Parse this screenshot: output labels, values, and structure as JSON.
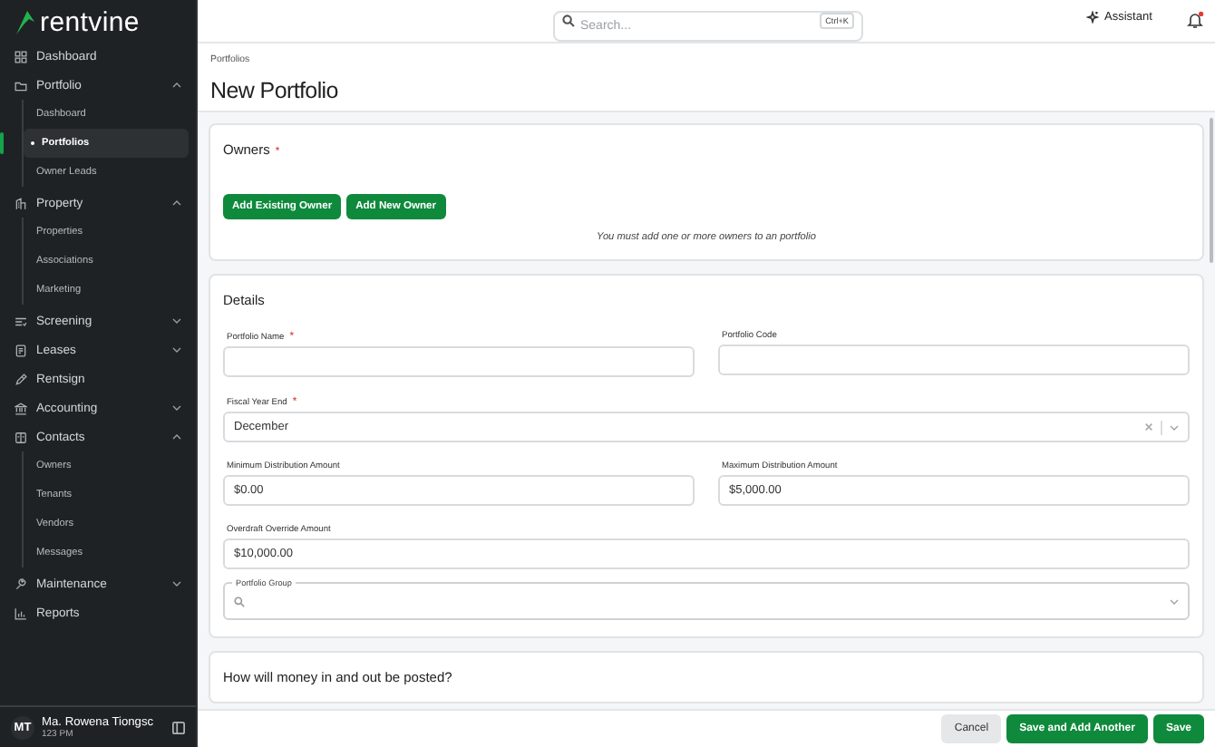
{
  "sidebar": {
    "logo": "rentvine",
    "items": [
      {
        "kind": "link",
        "label": "Dashboard"
      },
      {
        "kind": "group",
        "label": "Portfolio",
        "expanded": true,
        "children": [
          {
            "label": "Dashboard",
            "selected": false
          },
          {
            "label": "Portfolios",
            "selected": true
          },
          {
            "label": "Owner Leads",
            "selected": false
          }
        ]
      },
      {
        "kind": "group",
        "label": "Property",
        "expanded": true,
        "children": [
          {
            "label": "Properties",
            "selected": false
          },
          {
            "label": "Associations",
            "selected": false
          },
          {
            "label": "Marketing",
            "selected": false
          }
        ]
      },
      {
        "kind": "group",
        "label": "Screening",
        "expanded": false
      },
      {
        "kind": "group",
        "label": "Leases",
        "expanded": false
      },
      {
        "kind": "link",
        "label": "Rentsign"
      },
      {
        "kind": "group",
        "label": "Accounting",
        "expanded": false
      },
      {
        "kind": "group",
        "label": "Contacts",
        "expanded": true,
        "children": [
          {
            "label": "Owners",
            "selected": false
          },
          {
            "label": "Tenants",
            "selected": false
          },
          {
            "label": "Vendors",
            "selected": false
          },
          {
            "label": "Messages",
            "selected": false
          }
        ]
      },
      {
        "kind": "group",
        "label": "Maintenance",
        "expanded": false
      },
      {
        "kind": "link",
        "label": "Reports"
      }
    ],
    "user": {
      "initials": "MT",
      "name": "Ma. Rowena Tiongsc",
      "time": "123 PM"
    }
  },
  "topbar": {
    "search": {
      "placeholder": "Search...",
      "shortcut": "Ctrl+K"
    },
    "assistant": "Assistant",
    "notifications": {
      "unread": true
    }
  },
  "breadcrumb": "Portfolios",
  "title": "New Portfolio",
  "owners": {
    "title": "Owners",
    "required_mark": "*",
    "buttons": [
      "Add Existing Owner",
      "Add New Owner"
    ],
    "note": "You must add one or more owners to an portfolio"
  },
  "details": {
    "title": "Details",
    "rows": [
      [
        {
          "kind": "text",
          "label": "Portfolio Name",
          "required_mark": "*"
        },
        {
          "kind": "text",
          "label": "Portfolio Code"
        }
      ],
      [
        {
          "kind": "select",
          "label": "Fiscal Year End",
          "required_mark": "*",
          "value": "December"
        }
      ],
      [
        {
          "kind": "text",
          "label": "Minimum Distribution Amount",
          "value": "$0.00"
        },
        {
          "kind": "text",
          "label": "Maximum Distribution Amount",
          "value": "$5,000.00"
        }
      ],
      [
        {
          "kind": "text",
          "label": "Overdraft Override Amount",
          "value": "$10,000.00"
        }
      ],
      [
        {
          "kind": "search-select",
          "label": "Portfolio Group"
        }
      ]
    ]
  },
  "posting": {
    "title": "How will money in and out be posted?"
  },
  "footer": {
    "buttons": [
      {
        "label": "Cancel",
        "kind": "secondary"
      },
      {
        "label": "Save and Add Another",
        "kind": "primary"
      },
      {
        "label": "Save",
        "kind": "primary"
      }
    ]
  }
}
